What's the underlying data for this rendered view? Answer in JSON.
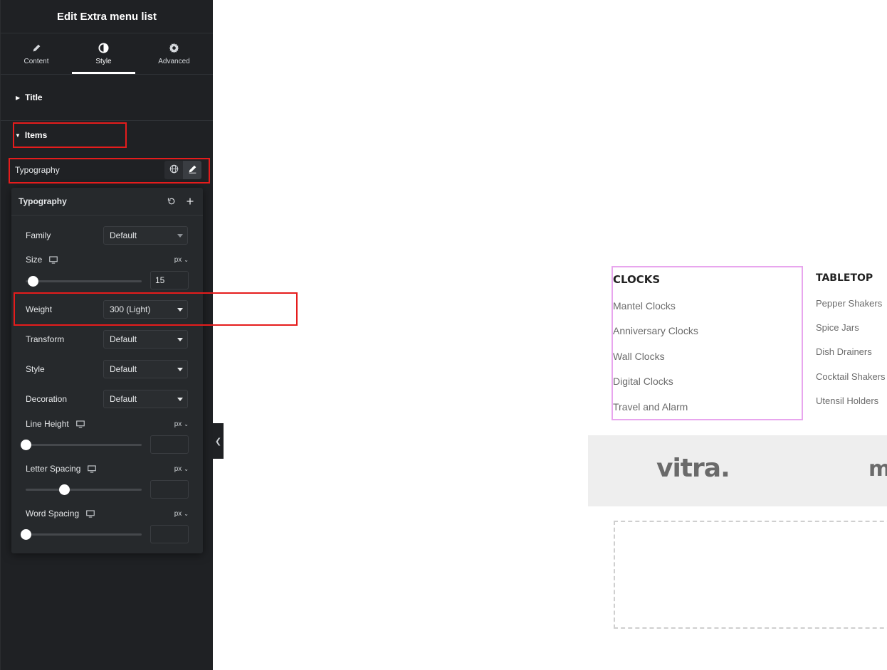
{
  "panel": {
    "title": "Edit Extra menu list",
    "tabs": [
      {
        "label": "Content",
        "icon": "pencil-icon"
      },
      {
        "label": "Style",
        "icon": "contrast-icon"
      },
      {
        "label": "Advanced",
        "icon": "gear-icon"
      }
    ],
    "active_tab": "Style",
    "sections": {
      "title": "Title",
      "items": "Items"
    },
    "typography_row": {
      "label": "Typography"
    },
    "popover": {
      "title": "Typography",
      "family": {
        "label": "Family",
        "value": "Default"
      },
      "size": {
        "label": "Size",
        "unit": "px",
        "value": "15",
        "slider_level": 0.06
      },
      "weight": {
        "label": "Weight",
        "value": "300 (Light)"
      },
      "transform": {
        "label": "Transform",
        "value": "Default"
      },
      "style": {
        "label": "Style",
        "value": "Default"
      },
      "decoration": {
        "label": "Decoration",
        "value": "Default"
      },
      "line_height": {
        "label": "Line Height",
        "unit": "px",
        "value": "",
        "slider_level": 0.0
      },
      "letter_spacing": {
        "label": "Letter Spacing",
        "unit": "px",
        "value": "",
        "slider_level": 0.33
      },
      "word_spacing": {
        "label": "Word Spacing",
        "unit": "px",
        "value": "",
        "slider_level": 0.0
      }
    }
  },
  "canvas": {
    "clocks": {
      "title": "CLOCKS",
      "items": [
        "Mantel Clocks",
        "Anniversary Clocks",
        "Wall Clocks",
        "Digital Clocks",
        "Travel and Alarm"
      ]
    },
    "tabletop": {
      "title": "TABLETOP",
      "items": [
        "Pepper Shakers",
        "Spice Jars",
        "Dish Drainers",
        "Cocktail Shakers",
        "Utensil Holders"
      ]
    },
    "brands": [
      "vitra.",
      "m"
    ]
  },
  "colors": {
    "panel_bg": "#1f2124",
    "highlight": "#e51c1c",
    "selection_outline": "#e8a6ee"
  }
}
